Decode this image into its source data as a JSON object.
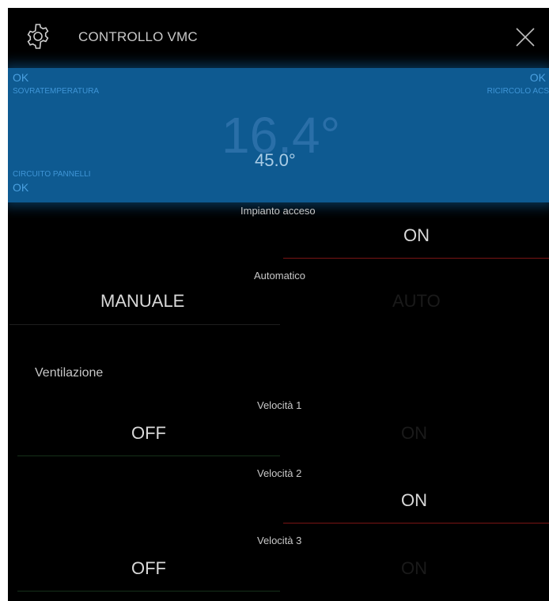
{
  "header": {
    "title": "CONTROLLO VMC"
  },
  "status": {
    "top_left_value": "OK",
    "top_left_label": "SOVRATEMPERATURA",
    "top_right_value": "OK",
    "top_right_label": "RICIRCOLO ACS",
    "temperature": "16.4°",
    "setpoint": "45.0°",
    "bottom_left_label": "CIRCUITO PANNELLI",
    "bottom_left_value": "OK"
  },
  "controls": {
    "impianto": {
      "label": "Impianto acceso",
      "on": "ON"
    },
    "automatico": {
      "label": "Automatico",
      "manual": "MANUALE",
      "auto": "AUTO"
    },
    "section_title": "Ventilazione",
    "velocita1": {
      "label": "Velocità 1",
      "off": "OFF",
      "on": "ON"
    },
    "velocita2": {
      "label": "Velocità 2",
      "on": "ON"
    },
    "velocita3": {
      "label": "Velocità 3",
      "off": "OFF",
      "on": "ON"
    }
  },
  "colors": {
    "status_bg": "#0e5a91",
    "active_red": "#8a1a1a",
    "active_green": "#1f3d1f",
    "inactive_line": "#2a2a2a"
  },
  "icons": {
    "settings": "gear-icon",
    "close": "close-icon"
  }
}
